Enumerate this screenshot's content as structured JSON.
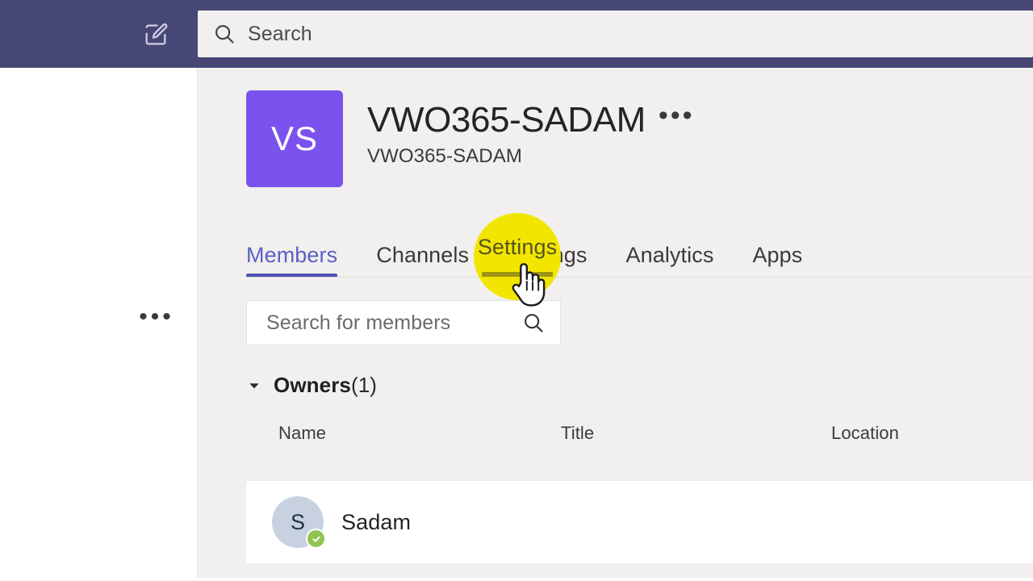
{
  "app": {
    "name": "Microsoft Teams",
    "accent_purple": "#464775",
    "team_avatar_purple": "#7b52ee",
    "tab_active_color": "#4f52b2",
    "highlight_yellow": "#f2e600",
    "presence_green": "#92c353",
    "content_bg": "#f1f0ee"
  },
  "topbar": {
    "compose_icon": "compose-pencil-icon",
    "search": {
      "icon": "search-icon",
      "placeholder": "Search",
      "value": ""
    }
  },
  "sidebar": {
    "more_options_label": "•••",
    "more_options_icon": "more-horizontal-icon"
  },
  "team": {
    "avatar_initials": "VS",
    "title": "VWO365-SADAM",
    "subtitle": "VWO365-SADAM",
    "more_options_label": "•••",
    "more_options_icon": "more-horizontal-icon"
  },
  "tabs": [
    {
      "label": "Members",
      "active": true
    },
    {
      "label": "Channels",
      "active": false
    },
    {
      "label": "Settings",
      "active": false
    },
    {
      "label": "Analytics",
      "active": false
    },
    {
      "label": "Apps",
      "active": false
    }
  ],
  "member_search": {
    "placeholder": "Search for members",
    "value": "",
    "icon": "search-icon"
  },
  "groups": [
    {
      "title": "Owners",
      "count": "(1)",
      "expanded": true,
      "chevron_icon": "chevron-down-icon",
      "columns": [
        "Name",
        "Title",
        "Location"
      ],
      "rows": [
        {
          "avatar_initial": "S",
          "name": "Sadam",
          "title": "",
          "location": "",
          "presence": "available",
          "presence_icon": "check-circle-icon"
        }
      ]
    }
  ],
  "cursor": {
    "target_tab": "Settings",
    "icon": "hand-pointer-cursor",
    "highlight_shape": "circle"
  }
}
